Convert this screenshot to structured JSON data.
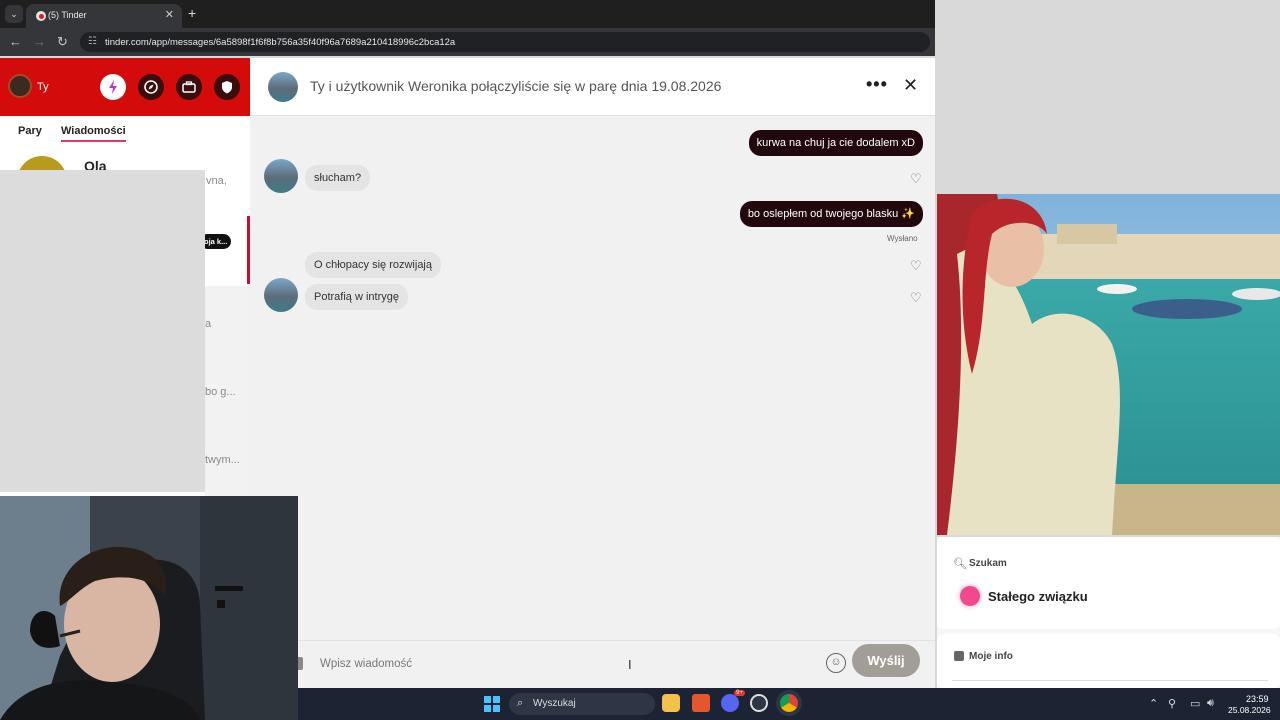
{
  "browser": {
    "tab_title": "(5) Tinder",
    "tab_close": "✕",
    "new_tab": "+",
    "tab_menu": "⌄",
    "url": "tinder.com/app/messages/6a5898f1f6f8b756a35f40f96a7689a210418996c2bca12a",
    "back": "←",
    "forward": "→",
    "reload": "↻",
    "site_info": "☷"
  },
  "sidebar": {
    "user_name": "Ty",
    "tabs": [
      "Pary",
      "Wiadomości"
    ],
    "conversations": [
      {
        "name": "Ola",
        "snippet": "vna,"
      }
    ],
    "active_badge": "oja k...",
    "snippets": [
      "a",
      "bo g...",
      "twym..."
    ]
  },
  "chat": {
    "header_text": "Ty i użytkownik Weronika połączyliście się w parę dnia 19.08.2026",
    "more": "•••",
    "close": "✕",
    "messages": [
      {
        "from": "me",
        "text": "kurwa na chuj ja cie dodalem xD"
      },
      {
        "from": "her",
        "text": "słucham?"
      },
      {
        "from": "me",
        "text": "bo oslepłem od twojego blasku ✨"
      },
      {
        "from": "her",
        "text": "O chłopacy się rozwijają"
      },
      {
        "from": "her",
        "text": "Potrafią w intrygę"
      }
    ],
    "sent_status": "Wysłano",
    "input_placeholder": "Wpisz wiadomość",
    "send_label": "Wyślij"
  },
  "profile": {
    "seeking_label": "Szukam",
    "seeking_value": "Stałego związku",
    "info_label": "Moje info"
  },
  "taskbar": {
    "search_placeholder": "Wyszukaj",
    "time": "23:59",
    "date": "25.08.2026",
    "discord_badge": "9+"
  },
  "colors": {
    "tinder_red": "#d30b0b",
    "accent_pink": "#e8365d",
    "outgoing_bubble": "#21080d",
    "send_button": "#a39d98"
  }
}
